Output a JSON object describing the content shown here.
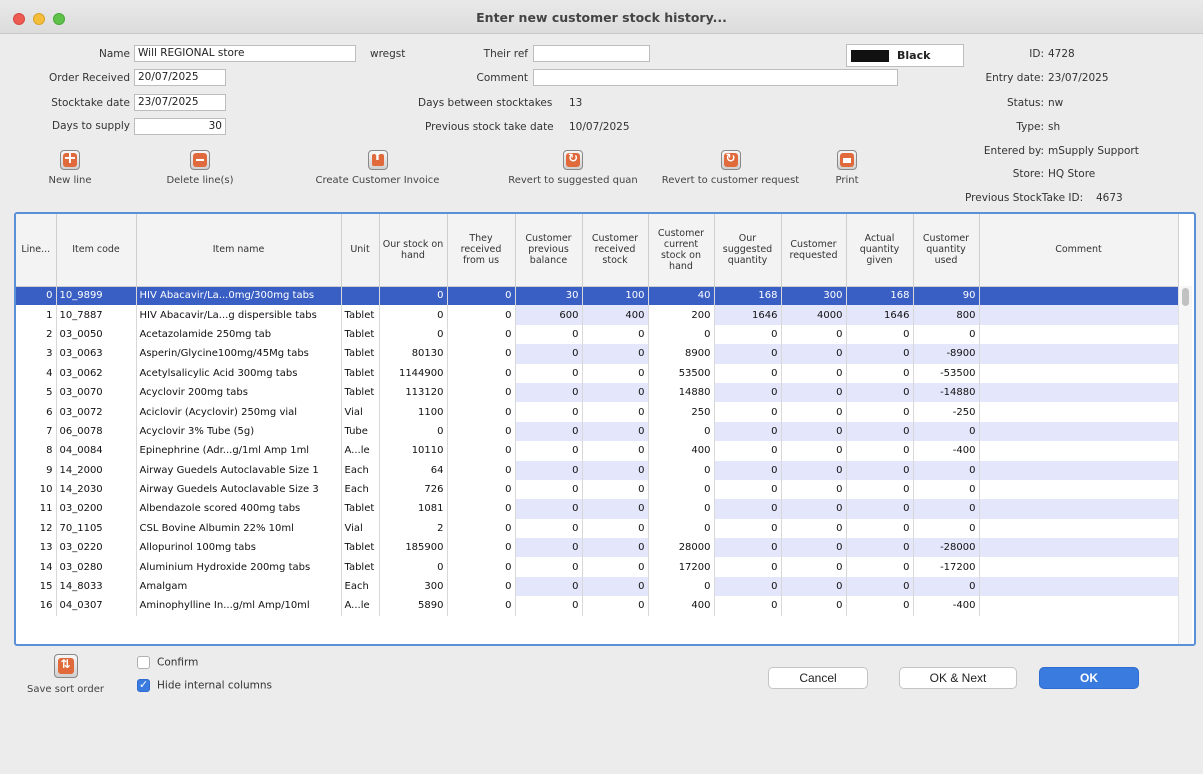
{
  "window": {
    "title": "Enter new customer stock history..."
  },
  "form": {
    "name_label": "Name",
    "name_value": "Will REGIONAL store",
    "name_code": "wregst",
    "order_received_label": "Order Received",
    "order_received_value": "20/07/2025",
    "stocktake_date_label": "Stocktake date",
    "stocktake_date_value": "23/07/2025",
    "days_to_supply_label": "Days to supply",
    "days_to_supply_value": "30",
    "their_ref_label": "Their ref",
    "their_ref_value": "",
    "comment_label": "Comment",
    "comment_value": "",
    "days_between_label": "Days between stocktakes",
    "days_between_value": "13",
    "prev_stocktake_date_label": "Previous stock take date",
    "prev_stocktake_date_value": "10/07/2025",
    "color_name": "Black",
    "color_hex": "#111111"
  },
  "info": {
    "id_label": "ID:",
    "id_value": "4728",
    "entry_date_label": "Entry date:",
    "entry_date_value": "23/07/2025",
    "status_label": "Status:",
    "status_value": "nw",
    "type_label": "Type:",
    "type_value": "sh",
    "entered_by_label": "Entered by:",
    "entered_by_value": "mSupply Support",
    "store_label": "Store:",
    "store_value": "HQ Store",
    "prev_stocktake_id_label": "Previous StockTake ID:",
    "prev_stocktake_id_value": "4673"
  },
  "toolbar": {
    "new_line": "New line",
    "delete_lines": "Delete line(s)",
    "create_invoice": "Create Customer Invoice",
    "revert_suggested": "Revert to suggested quan",
    "revert_customer": "Revert to customer request",
    "print": "Print"
  },
  "table": {
    "headers": [
      "Line...",
      "Item code",
      "Item name",
      "Unit",
      "Our stock on hand",
      "They received from us",
      "Customer previous balance",
      "Customer received stock",
      "Customer current stock on hand",
      "Our suggested quantity",
      "Customer requested",
      "Actual quantity given",
      "Customer quantity used",
      "Comment"
    ],
    "rows": [
      [
        "0",
        "10_9899",
        "HIV Abacavir/La...0mg/300mg tabs",
        "",
        "0",
        "0",
        "30",
        "100",
        "40",
        "168",
        "300",
        "168",
        "90",
        ""
      ],
      [
        "1",
        "10_7887",
        "HIV Abacavir/La...g dispersible tabs",
        "Tablet",
        "0",
        "0",
        "600",
        "400",
        "200",
        "1646",
        "4000",
        "1646",
        "800",
        ""
      ],
      [
        "2",
        "03_0050",
        "Acetazolamide 250mg tab",
        "Tablet",
        "0",
        "0",
        "0",
        "0",
        "0",
        "0",
        "0",
        "0",
        "0",
        ""
      ],
      [
        "3",
        "03_0063",
        "Asperin/Glycine100mg/45Mg tabs",
        "Tablet",
        "80130",
        "0",
        "0",
        "0",
        "8900",
        "0",
        "0",
        "0",
        "-8900",
        ""
      ],
      [
        "4",
        "03_0062",
        "Acetylsalicylic Acid 300mg tabs",
        "Tablet",
        "1144900",
        "0",
        "0",
        "0",
        "53500",
        "0",
        "0",
        "0",
        "-53500",
        ""
      ],
      [
        "5",
        "03_0070",
        "Acyclovir 200mg tabs",
        "Tablet",
        "113120",
        "0",
        "0",
        "0",
        "14880",
        "0",
        "0",
        "0",
        "-14880",
        ""
      ],
      [
        "6",
        "03_0072",
        "Aciclovir (Acyclovir) 250mg vial",
        "Vial",
        "1100",
        "0",
        "0",
        "0",
        "250",
        "0",
        "0",
        "0",
        "-250",
        ""
      ],
      [
        "7",
        "06_0078",
        "Acyclovir 3% Tube (5g)",
        "Tube",
        "0",
        "0",
        "0",
        "0",
        "0",
        "0",
        "0",
        "0",
        "0",
        ""
      ],
      [
        "8",
        "04_0084",
        "Epinephrine (Adr...g/1ml Amp 1ml",
        "A...le",
        "10110",
        "0",
        "0",
        "0",
        "400",
        "0",
        "0",
        "0",
        "-400",
        ""
      ],
      [
        "9",
        "14_2000",
        "Airway Guedels Autoclavable Size 1",
        "Each",
        "64",
        "0",
        "0",
        "0",
        "0",
        "0",
        "0",
        "0",
        "0",
        ""
      ],
      [
        "10",
        "14_2030",
        "Airway Guedels Autoclavable Size 3",
        "Each",
        "726",
        "0",
        "0",
        "0",
        "0",
        "0",
        "0",
        "0",
        "0",
        ""
      ],
      [
        "11",
        "03_0200",
        "Albendazole scored 400mg tabs",
        "Tablet",
        "1081",
        "0",
        "0",
        "0",
        "0",
        "0",
        "0",
        "0",
        "0",
        ""
      ],
      [
        "12",
        "70_1105",
        "CSL Bovine Albumin 22% 10ml",
        "Vial",
        "2",
        "0",
        "0",
        "0",
        "0",
        "0",
        "0",
        "0",
        "0",
        ""
      ],
      [
        "13",
        "03_0220",
        "Allopurinol 100mg tabs",
        "Tablet",
        "185900",
        "0",
        "0",
        "0",
        "28000",
        "0",
        "0",
        "0",
        "-28000",
        ""
      ],
      [
        "14",
        "03_0280",
        "Aluminium Hydroxide 200mg tabs",
        "Tablet",
        "0",
        "0",
        "0",
        "0",
        "17200",
        "0",
        "0",
        "0",
        "-17200",
        ""
      ],
      [
        "15",
        "14_8033",
        "Amalgam",
        "Each",
        "300",
        "0",
        "0",
        "0",
        "0",
        "0",
        "0",
        "0",
        "0",
        ""
      ],
      [
        "16",
        "04_0307",
        "Aminophylline In...g/ml Amp/10ml",
        "A...le",
        "5890",
        "0",
        "0",
        "0",
        "400",
        "0",
        "0",
        "0",
        "-400",
        ""
      ]
    ]
  },
  "footer": {
    "save_sort": "Save sort order",
    "confirm": "Confirm",
    "hide_internal": "Hide internal columns",
    "cancel": "Cancel",
    "ok_next": "OK & Next",
    "ok": "OK"
  }
}
